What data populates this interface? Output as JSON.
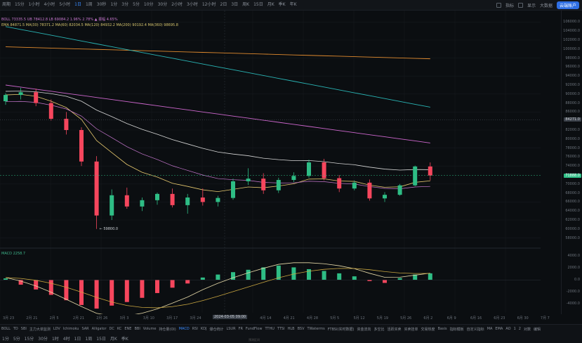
{
  "topbar": {
    "timeframes": [
      "周期",
      "15分",
      "1小时",
      "4小时",
      "5小时",
      "1日",
      "1周",
      "30秒",
      "1分",
      "3分",
      "5分",
      "10分",
      "30分",
      "2小时",
      "3小时",
      "12小时",
      "2日",
      "3日",
      "周K",
      "15日",
      "月K",
      "季K",
      "年K"
    ],
    "active_index": 5,
    "right_buttons": [
      "指标",
      "显示",
      "大数据"
    ],
    "account_label": "云端账户"
  },
  "legend": {
    "line1": "BOLL 73335.5  UB 78412.8  LB 69084.2  1.96%  2.78% ▲  振幅 4.65%",
    "line2": "EMA 84871.5  MA(30) 78371.2  MA(60) 82034.5  MA(120) 84932.2  MA(200) 90192.4  MA(360) 98695.8",
    "macd": "MACD 2258.7"
  },
  "price_axis": {
    "labels": [
      "106000.0",
      "104000.0",
      "102000.0",
      "100000.0",
      "98000.0",
      "96000.0",
      "94000.0",
      "92000.0",
      "90000.0",
      "88000.0",
      "86000.0",
      "84000.0",
      "82000.0",
      "80000.0",
      "78000.0",
      "76000.0",
      "74000.0",
      "72000.0",
      "70000.0",
      "68000.0",
      "66000.0",
      "64000.0",
      "62000.0",
      "60000.0",
      "58000.0"
    ],
    "current_price": "71888.0",
    "marker_price": "84271.0",
    "low_label": "← 59800.0",
    "macd_labels": [
      "4000.0",
      "2000.0",
      "0.0",
      "-2000.0",
      "-4000.0"
    ]
  },
  "date_axis": {
    "labels": [
      "3月 23",
      "2月 21",
      "2月 5",
      "2月 21",
      "2月 26",
      "3月 3",
      "3月 10",
      "3月 17",
      "3月 24",
      "3月 31",
      "4月 7",
      "4月 14",
      "4月 21",
      "4月 28",
      "5月 5",
      "5月 12",
      "5月 19",
      "5月 26",
      "6月 2",
      "6月 9",
      "6月 16",
      "6月 23",
      "6月 30",
      "7月 7"
    ],
    "highlight": "2024-03-05 09:00"
  },
  "indicators": {
    "items": [
      "BOLL",
      "TD",
      "SBI",
      "主力大单监测",
      "LDV",
      "Ichimoku",
      "SAR",
      "Alligator",
      "DC",
      "KC",
      "ENE",
      "BBI",
      "Volume",
      "持仓量(OI)",
      "MACD",
      "RSI",
      "KDJ",
      "爆仓统计",
      "LSUR",
      "FR",
      "FundFlow",
      "TTHU",
      "TTSI",
      "HLB",
      "BSV",
      "TWaterms",
      "FTBSI(实时数据)",
      "资金流向",
      "多空比",
      "活跃买卖",
      "买卖挂单",
      "交易热度",
      "Basis",
      "指标模板",
      "自定义指标",
      "MA",
      "EMA",
      "AO",
      "1",
      "2",
      "对数",
      "编辑"
    ],
    "active_index": 14
  },
  "bottombar": {
    "items": [
      "1分",
      "5分",
      "15分",
      "30分",
      "1时",
      "4时",
      "1日",
      "1周",
      "15日",
      "月K",
      "季K"
    ],
    "center": "预测区间"
  },
  "colors": {
    "up": "#2ebd85",
    "down": "#f6465d",
    "ema_fast": "#e6c86e",
    "ema_mid": "#d6d6d6",
    "ma120": "#cc66cc",
    "ma200": "#29b3b3",
    "ma360": "#e08a2e",
    "boll_band": "#c878d0"
  },
  "chart_data": {
    "type": "candlestick",
    "x": [
      "1/21",
      "1/24",
      "1/27",
      "1/30",
      "2/02",
      "2/05",
      "2/08",
      "2/11",
      "2/14",
      "2/17",
      "2/20",
      "2/23",
      "2/26",
      "3/01",
      "3/04",
      "3/07",
      "3/10",
      "3/13",
      "3/16",
      "3/19",
      "3/22",
      "3/25",
      "3/28",
      "3/31",
      "4/03",
      "4/06",
      "4/09",
      "4/12",
      "4/15"
    ],
    "ohlc": [
      [
        88400,
        90200,
        87600,
        89800
      ],
      [
        89800,
        91400,
        88800,
        90400
      ],
      [
        90400,
        91200,
        87300,
        88000
      ],
      [
        88000,
        88800,
        84100,
        84500
      ],
      [
        84500,
        86000,
        81000,
        82000
      ],
      [
        82000,
        82600,
        74000,
        75000
      ],
      [
        75000,
        76200,
        60000,
        63000
      ],
      [
        63000,
        68800,
        62000,
        67500
      ],
      [
        67500,
        69200,
        64500,
        65000
      ],
      [
        65000,
        67000,
        64000,
        66400
      ],
      [
        66400,
        68100,
        65400,
        67800
      ],
      [
        67800,
        69000,
        64800,
        65300
      ],
      [
        65300,
        67800,
        63400,
        67000
      ],
      [
        67000,
        69000,
        65200,
        66000
      ],
      [
        66000,
        67400,
        65000,
        66900
      ],
      [
        66900,
        71200,
        66500,
        70600
      ],
      [
        70600,
        73500,
        69800,
        71200
      ],
      [
        71200,
        72400,
        67800,
        68600
      ],
      [
        68600,
        71400,
        68000,
        70900
      ],
      [
        70900,
        72600,
        70400,
        71800
      ],
      [
        71800,
        75400,
        71400,
        74800
      ],
      [
        74800,
        75600,
        70800,
        71300
      ],
      [
        71300,
        72000,
        68200,
        69000
      ],
      [
        69000,
        70800,
        68600,
        70300
      ],
      [
        70300,
        71000,
        66300,
        66800
      ],
      [
        66800,
        68200,
        66000,
        67600
      ],
      [
        67600,
        70000,
        67400,
        69700
      ],
      [
        69700,
        74100,
        69500,
        73900
      ],
      [
        73900,
        74800,
        70800,
        71900
      ]
    ],
    "price_range": [
      57000,
      107000
    ],
    "macd_hist": [
      250,
      -800,
      -1600,
      -2500,
      -3400,
      -4200,
      -4800,
      -4300,
      -3700,
      -3000,
      -2200,
      -1300,
      -600,
      400,
      900,
      1300,
      1700,
      2100,
      2400,
      2100,
      1800,
      1500,
      1100,
      600,
      -200,
      -500,
      300,
      900,
      1100
    ],
    "macd_range": [
      -5500,
      4500
    ],
    "grid": true
  }
}
